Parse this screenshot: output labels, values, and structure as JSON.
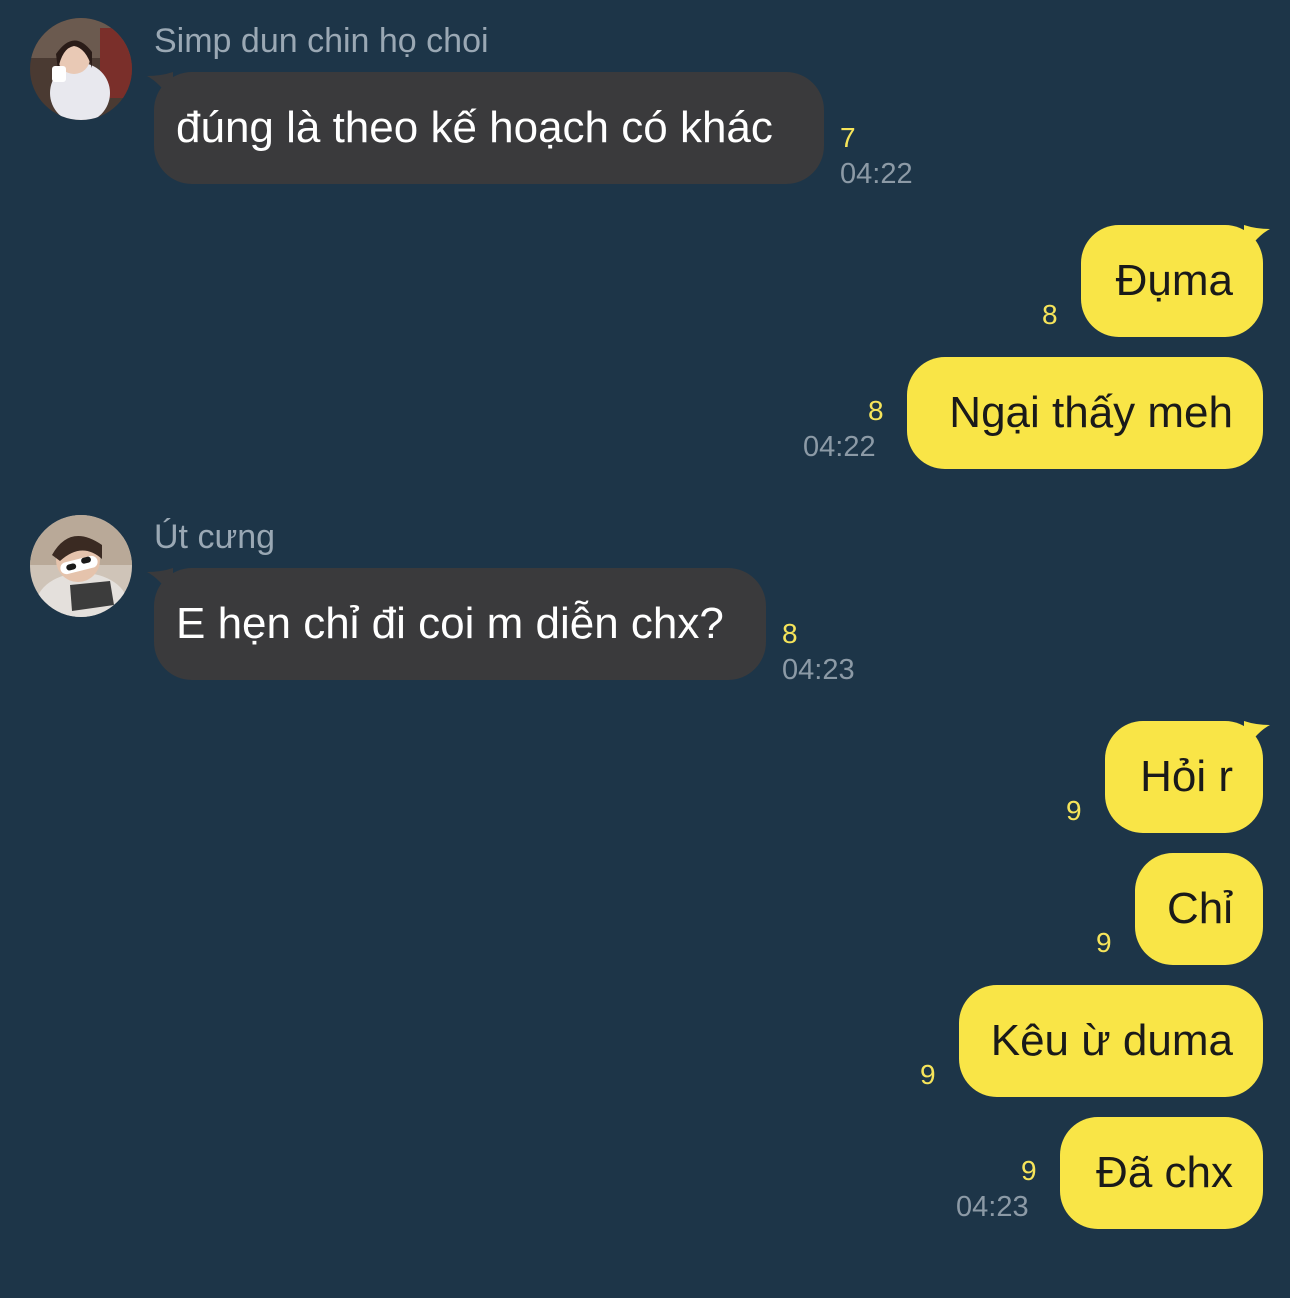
{
  "colors": {
    "background": "#1d3548",
    "incoming_bubble": "#3a3a3c",
    "outgoing_bubble": "#f9e547",
    "unread_count": "#f6e45a",
    "timestamp": "#8c9aa6",
    "sender_name": "#9aa8b4"
  },
  "messages": [
    {
      "direction": "incoming",
      "sender": "Simp dun chin họ choi",
      "avatar": "avatar-girl-white-shirt",
      "text": "đúng là theo kế hoạch có khác",
      "unread_count": "7",
      "time": "04:22"
    },
    {
      "direction": "outgoing",
      "text": "Đụma",
      "unread_count": "8"
    },
    {
      "direction": "outgoing",
      "text": "Ngại thấy meh",
      "unread_count": "8",
      "time": "04:22"
    },
    {
      "direction": "incoming",
      "sender": "Út cưng",
      "avatar": "avatar-girl-white-sunglasses",
      "text": "E hẹn chỉ đi coi m diễn chx?",
      "unread_count": "8",
      "time": "04:23"
    },
    {
      "direction": "outgoing",
      "text": "Hỏi r",
      "unread_count": "9"
    },
    {
      "direction": "outgoing",
      "text": "Chỉ",
      "unread_count": "9"
    },
    {
      "direction": "outgoing",
      "text": "Kêu ừ duma",
      "unread_count": "9"
    },
    {
      "direction": "outgoing",
      "text": "Đã chx",
      "unread_count": "9",
      "time": "04:23"
    }
  ]
}
